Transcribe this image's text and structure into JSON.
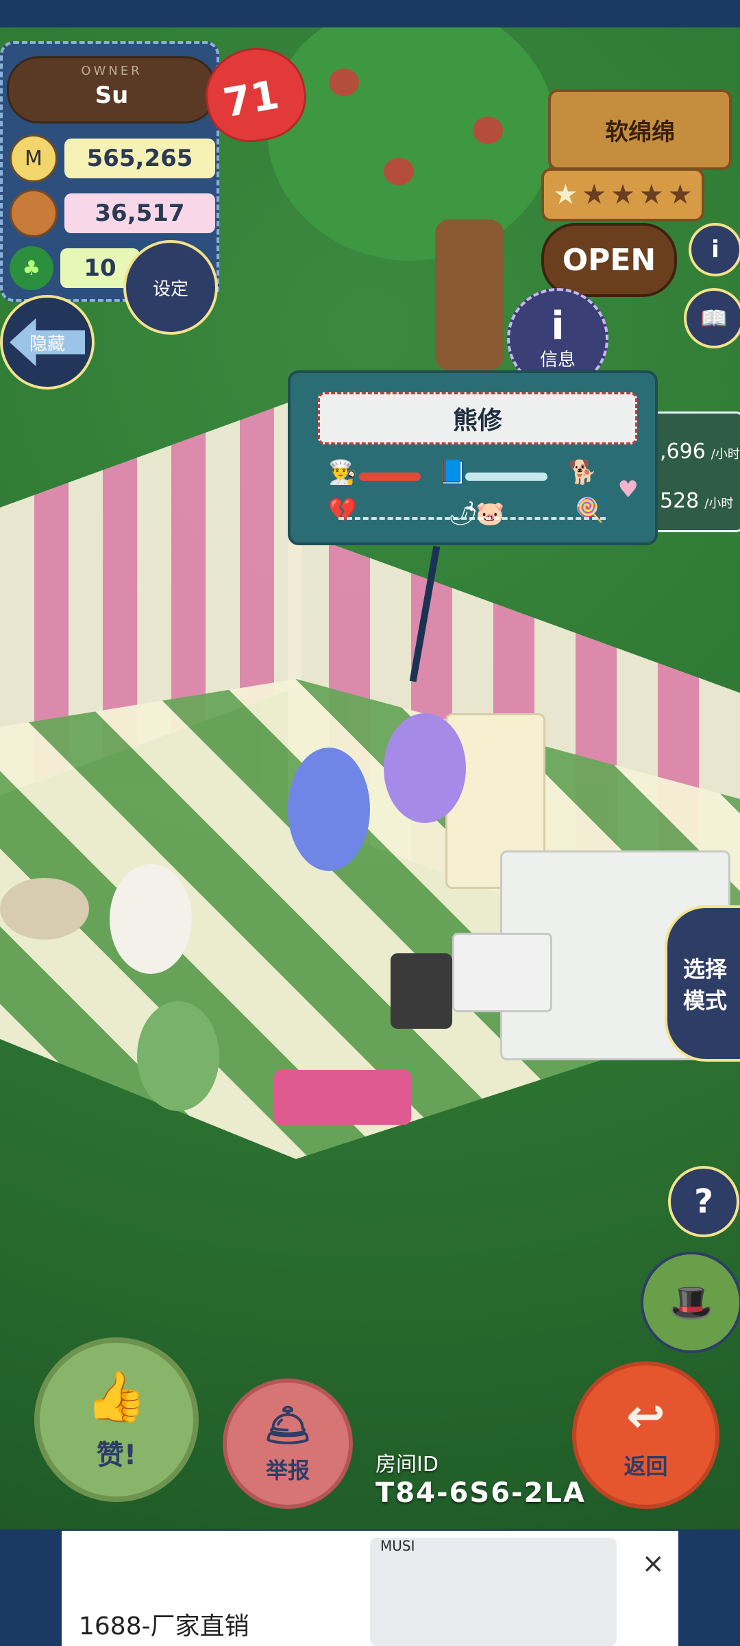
{
  "owner": {
    "label": "OWNER",
    "name": "Su",
    "level": "71"
  },
  "stats": {
    "coins": "565,265",
    "ingredients": "36,517",
    "clovers": "10"
  },
  "buttons": {
    "settings": "设定",
    "hide": "隐藏",
    "info": "信息",
    "select_mode": "选择模式",
    "help": "?",
    "like": "赞!",
    "report": "举报",
    "return": "返回"
  },
  "shop": {
    "name": "软绵绵",
    "open_label": "OPEN",
    "stars_total": 5,
    "stars_active": 1
  },
  "income_panel": {
    "row1_value": ",696",
    "row1_unit": "/小时",
    "row2_value": "528",
    "row2_unit": "/小时"
  },
  "customer_card": {
    "name": "熊修"
  },
  "room": {
    "id_label": "房间ID",
    "id_value": "T84-6S6-2LA"
  },
  "ad": {
    "text": "1688-厂家直销",
    "brand": "MUSI"
  },
  "icons": {
    "coin": "M",
    "clover": "♣",
    "info": "i",
    "book": "📖",
    "hat": "🎩",
    "like": "👍",
    "whistle": "🛎",
    "return": "↩",
    "close": "×"
  },
  "colors": {
    "panel_blue": "#2c4f7e",
    "accent_yellow": "#f2e38b",
    "heart_red": "#e23a3a"
  }
}
